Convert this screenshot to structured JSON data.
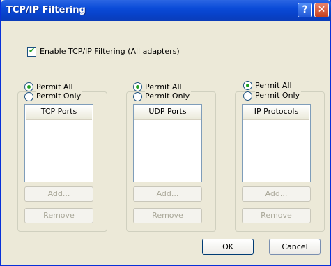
{
  "titlebar": {
    "title": "TCP/IP Filtering",
    "help_glyph": "?",
    "close_glyph": "✕"
  },
  "enable": {
    "label": "Enable TCP/IP Filtering (All adapters)",
    "checked": true
  },
  "groups": [
    {
      "permit_all": "Permit All",
      "permit_only": "Permit Only",
      "list_header": "TCP Ports",
      "add": "Add...",
      "remove": "Remove",
      "selected": "permit_all"
    },
    {
      "permit_all": "Permit All",
      "permit_only": "Permit Only",
      "list_header": "UDP Ports",
      "add": "Add...",
      "remove": "Remove",
      "selected": "permit_all"
    },
    {
      "permit_all": "Permit All",
      "permit_only": "Permit Only",
      "list_header": "IP Protocols",
      "add": "Add...",
      "remove": "Remove",
      "selected": "permit_all"
    }
  ],
  "buttons": {
    "ok": "OK",
    "cancel": "Cancel"
  },
  "colors": {
    "titlebar": "#0a4bd8",
    "dialog_bg": "#ece9d8",
    "check": "#21a121",
    "close": "#c9401d"
  }
}
